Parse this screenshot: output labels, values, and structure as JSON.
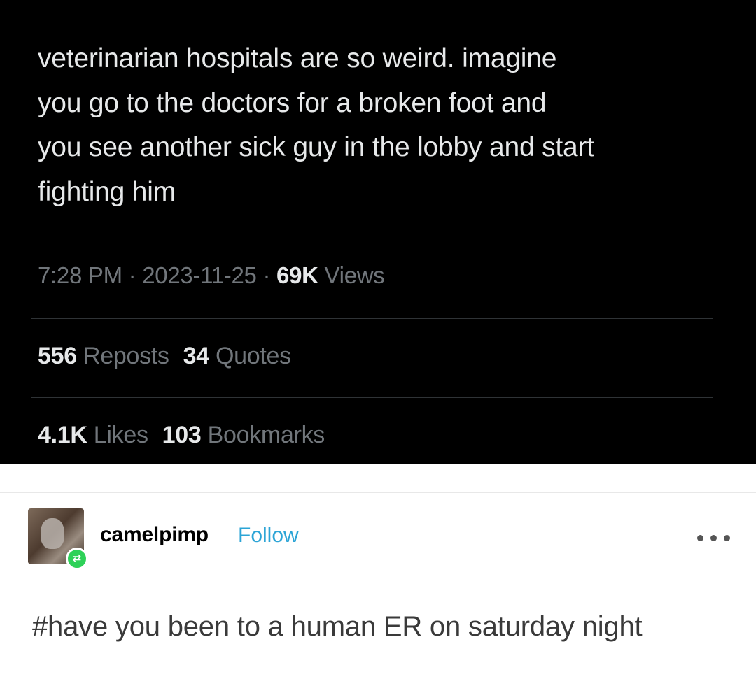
{
  "tweet": {
    "text": "veterinarian hospitals are so weird. imagine\nyou go to the doctors for a broken foot and\nyou see another sick guy in the lobby and start\nfighting him",
    "time": "7:28 PM",
    "date": "2023-11-25",
    "views_count": "69K",
    "views_label": "Views",
    "reposts_count": "556",
    "reposts_label": "Reposts",
    "quotes_count": "34",
    "quotes_label": "Quotes",
    "likes_count": "4.1K",
    "likes_label": "Likes",
    "bookmarks_count": "103",
    "bookmarks_label": "Bookmarks",
    "meta_separator": " · "
  },
  "reblog": {
    "username": "camelpimp",
    "follow_label": "Follow",
    "tag_text": "#have you been to a human ER on saturday night",
    "avatar_icon": "avatar-photo",
    "badge_icon": "reblog-icon",
    "more_icon": "more-options-icon"
  },
  "colors": {
    "tweet_background": "#000000",
    "tweet_text": "#e7e9ea",
    "tweet_muted": "#71767b",
    "follow_link": "#2ba4d6",
    "reblog_badge": "#2ed158"
  }
}
